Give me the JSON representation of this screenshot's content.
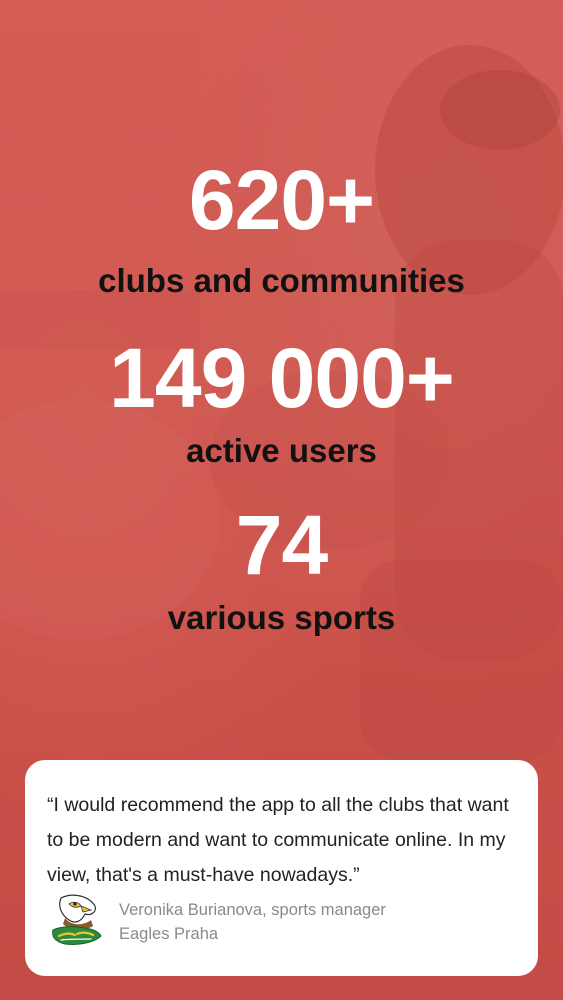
{
  "stats": [
    {
      "value": "620+",
      "label": "clubs and communities"
    },
    {
      "value": "149 000+",
      "label": "active users"
    },
    {
      "value": "74",
      "label": "various sports"
    }
  ],
  "testimonial": {
    "quote": "“I would recommend the app to all the clubs that want to be modern and want to communicate online. In my view, that's a must-have nowadays.”",
    "author": "Veronika Burianova, sports manager",
    "club": "Eagles Praha",
    "logo_icon": "eagles-logo-icon"
  },
  "colors": {
    "background": "#cf554e",
    "number": "#ffffff",
    "label": "#111111",
    "card": "#ffffff",
    "author": "#8a8a8a",
    "logo_green": "#2e8b3e",
    "logo_yellow": "#f2c230"
  }
}
